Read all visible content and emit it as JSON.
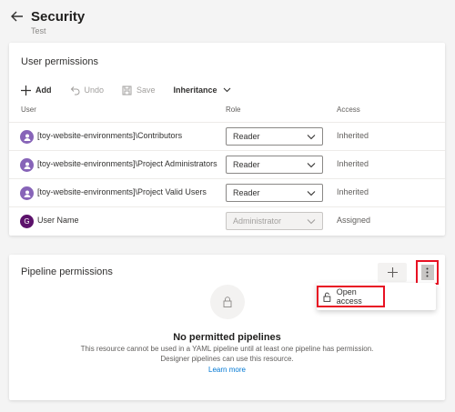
{
  "header": {
    "title": "Security",
    "subtitle": "Test"
  },
  "user_permissions": {
    "title": "User permissions",
    "toolbar": {
      "add": "Add",
      "undo": "Undo",
      "save": "Save",
      "inheritance": "Inheritance"
    },
    "columns": {
      "user": "User",
      "role": "Role",
      "access": "Access"
    },
    "rows": [
      {
        "name": "[toy-website-environments]\\Contributors",
        "avatar": "group",
        "role": "Reader",
        "access": "Inherited",
        "disabled": false
      },
      {
        "name": "[toy-website-environments]\\Project Administrators",
        "avatar": "group",
        "role": "Reader",
        "access": "Inherited",
        "disabled": false
      },
      {
        "name": "[toy-website-environments]\\Project Valid Users",
        "avatar": "group",
        "role": "Reader",
        "access": "Inherited",
        "disabled": false
      },
      {
        "name": "User Name",
        "avatar": "G",
        "role": "Administrator",
        "access": "Assigned",
        "disabled": true
      }
    ]
  },
  "pipeline_permissions": {
    "title": "Pipeline permissions",
    "menu": {
      "open_access": "Open access"
    },
    "empty": {
      "title": "No permitted pipelines",
      "line1": "This resource cannot be used in a YAML pipeline until at least one pipeline has permission.",
      "line2": "Designer pipelines can use this resource.",
      "link": "Learn more"
    }
  },
  "colors": {
    "accent": "#0078d4",
    "highlight": "#e81123",
    "group_avatar": "#8764b8",
    "user_avatar": "#5c126b"
  }
}
